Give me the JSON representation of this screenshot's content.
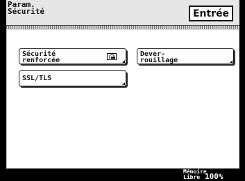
{
  "header": {
    "title": "Param.\nSécurité",
    "enter_label": "Entrée"
  },
  "options": [
    {
      "label": "Sécurité\nrenforcée",
      "icon": "lock-icon"
    },
    {
      "label": "Dever-\nrouillage"
    },
    {
      "label": "SSL/TLS"
    }
  ],
  "footer": {
    "memory_label": "Mémoire\nLibre",
    "memory_value": "100%"
  }
}
